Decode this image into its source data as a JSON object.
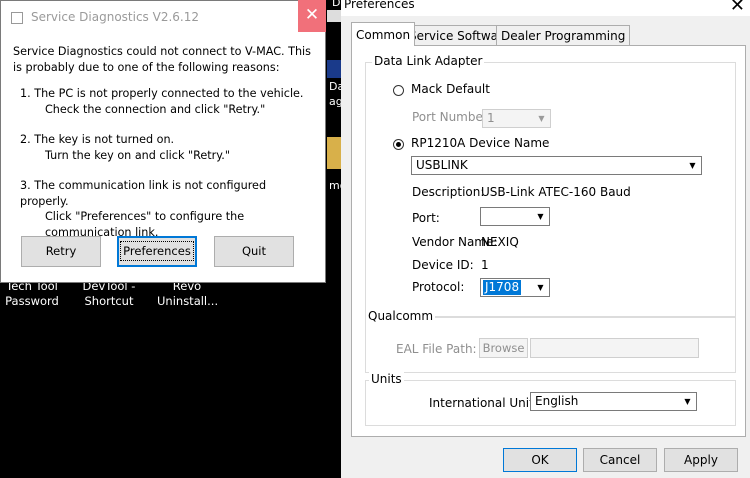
{
  "desktop": {
    "icons": [
      {
        "label": "Tech Tool Password"
      },
      {
        "label": "DevTool - Shortcut"
      },
      {
        "label": "Revo Uninstall..."
      }
    ],
    "peek_texts": [
      "DC",
      "Da",
      "ag",
      "mo"
    ]
  },
  "service_dialog": {
    "title": "Service Diagnostics  V2.6.12",
    "close_glyph": "✕",
    "intro": "Service Diagnostics could not connect to V-MAC.  This is probably due to one of the following reasons:",
    "reasons": [
      {
        "line1": "1. The PC is not properly connected to the vehicle.",
        "line2": "Check the connection and click \"Retry.\""
      },
      {
        "line1": "2. The key is not turned on.",
        "line2": "Turn the key on and click \"Retry.\""
      },
      {
        "line1": "3. The communication link is not configured properly.",
        "line2": "Click \"Preferences\" to configure the communication link."
      }
    ],
    "buttons": {
      "retry": "Retry",
      "preferences": "Preferences",
      "quit": "Quit"
    }
  },
  "preferences_dialog": {
    "title": "Preferences",
    "close_glyph": "✕",
    "tabs": [
      "Common",
      "Service Software",
      "Dealer Programming"
    ],
    "active_tab": "Common",
    "data_link_adapter": {
      "group_label": "Data Link Adapter",
      "mack_default_label": "Mack Default",
      "port_number_label": "Port Number",
      "port_number_value": "1",
      "rp1210a_label": "RP1210A Device Name",
      "selected_option": "RP1210A Device Name",
      "device_value": "USBLINK",
      "description_label": "Description:",
      "description_value": "USB-Link ATEC-160 Baud",
      "port_label": "Port:",
      "port_value": "",
      "vendor_label": "Vendor Name:",
      "vendor_value": "NEXIQ",
      "device_id_label": "Device ID:",
      "device_id_value": "1",
      "protocol_label": "Protocol:",
      "protocol_value": "J1708"
    },
    "qualcomm": {
      "group_label": "Qualcomm",
      "eal_label": "EAL File Path:",
      "browse_label": "Browse",
      "eal_value": ""
    },
    "units": {
      "group_label": "Units",
      "intl_label": "International Units:",
      "intl_value": "English"
    },
    "buttons": {
      "ok": "OK",
      "cancel": "Cancel",
      "apply": "Apply"
    }
  },
  "colors": {
    "accent": "#0078d7",
    "close_red": "#f1707a",
    "desktop_bg": "#000000"
  }
}
